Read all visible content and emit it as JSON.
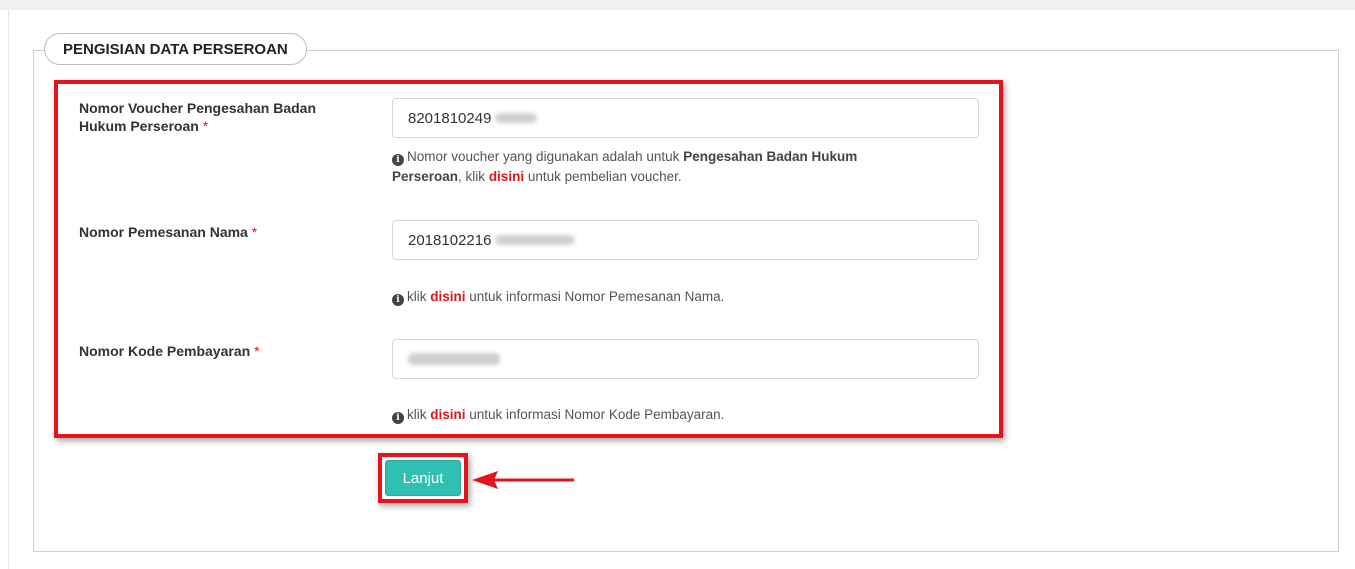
{
  "form": {
    "title": "PENGISIAN DATA PERSEROAN",
    "required_mark": "*",
    "fields": [
      {
        "label_line1": "Nomor Voucher Pengesahan Badan",
        "label_line2": "Hukum Perseroan",
        "value": "8201810249",
        "help": {
          "prefix": "Nomor voucher yang digunakan adalah untuk ",
          "bold1": "Pengesahan Badan Hukum",
          "bold2": "Perseroan",
          "middle": ", klik ",
          "link": "disini",
          "suffix": " untuk pembelian voucher."
        }
      },
      {
        "label": "Nomor Pemesanan Nama",
        "value": "2018102216",
        "help": {
          "prefix": "klik ",
          "link": "disini",
          "suffix": " untuk informasi Nomor Pemesanan Nama."
        }
      },
      {
        "label": "Nomor Kode Pembayaran",
        "value": "",
        "help": {
          "prefix": "klik ",
          "link": "disini",
          "suffix": " untuk informasi Nomor Kode Pembayaran."
        }
      }
    ],
    "submit_label": "Lanjut"
  },
  "colors": {
    "highlight": "#e3141c",
    "button": "#2fbfb3",
    "link": "#e3141c"
  },
  "icons": {
    "info": "info-circle-icon",
    "annotation_arrow": "arrow-left-icon"
  }
}
